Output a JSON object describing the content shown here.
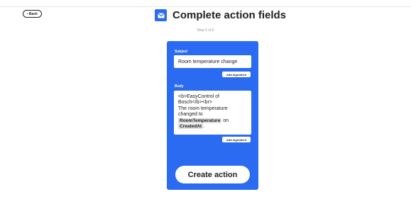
{
  "back_label": "Back",
  "title": "Complete action fields",
  "step_text": "Step 5 of 6",
  "form": {
    "subject_label": "Subject",
    "subject_value": "Room temperature change",
    "add_ingredient_label": "Add ingredient",
    "body_label": "Body",
    "body_line1": "<b>EasyControl of",
    "body_line2": "Bosch</b><br>",
    "body_line3": "The room temperature",
    "body_line4": "changed to",
    "ingredient1": "RoomTemperature",
    "body_on": "on",
    "ingredient2": "CreatedAt",
    "body_end": ".",
    "create_label": "Create action"
  },
  "colors": {
    "accent": "#2a6bf2"
  },
  "icons": {
    "service": "mail-icon",
    "back": "chevron-left-icon"
  }
}
